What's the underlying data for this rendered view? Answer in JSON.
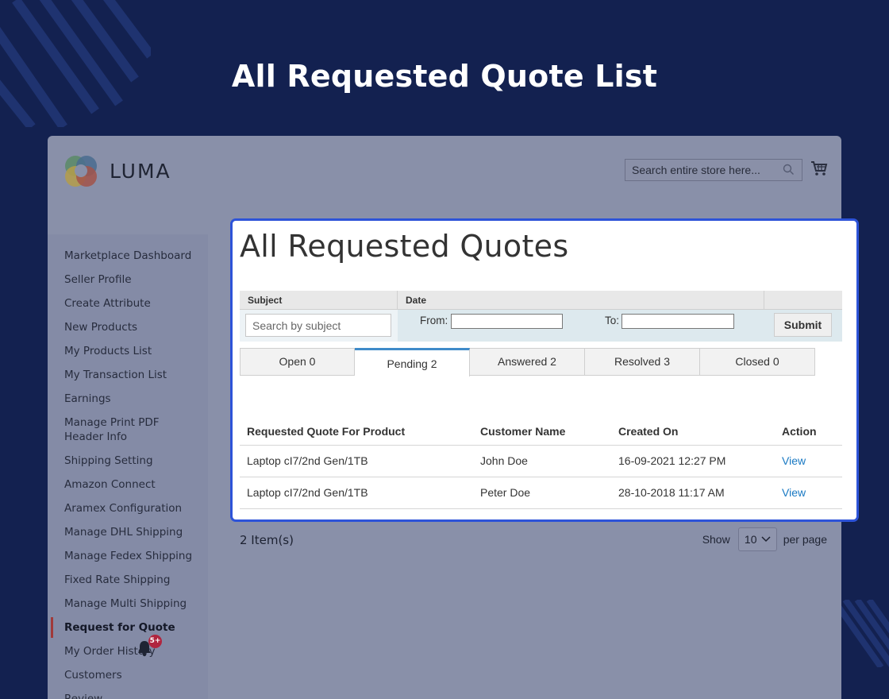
{
  "hero": {
    "title": "All Requested Quote List"
  },
  "colors": {
    "background": "#132150",
    "panel_border": "#2d53d8",
    "link": "#1979c3",
    "tab_active": "#3f8bc9",
    "badge": "#b0253f"
  },
  "header": {
    "logo_text": "LUMA",
    "search_placeholder": "Search entire store here...",
    "search_icon": "search-icon",
    "cart_icon": "cart-icon"
  },
  "sidebar": {
    "items": [
      {
        "label": "Marketplace Dashboard"
      },
      {
        "label": "Seller Profile"
      },
      {
        "label": "Create Attribute"
      },
      {
        "label": "New Products"
      },
      {
        "label": "My Products List"
      },
      {
        "label": "My Transaction List"
      },
      {
        "label": "Earnings"
      },
      {
        "label": "Manage Print PDF Header Info"
      },
      {
        "label": "Shipping Setting"
      },
      {
        "label": "Amazon Connect"
      },
      {
        "label": "Aramex Configuration"
      },
      {
        "label": "Manage DHL Shipping"
      },
      {
        "label": "Manage Fedex Shipping"
      },
      {
        "label": "Fixed Rate Shipping"
      },
      {
        "label": "Manage Multi Shipping"
      },
      {
        "label": "Request for Quote",
        "active": true
      },
      {
        "label": "My Order History",
        "badge": "5+"
      },
      {
        "label": "Customers"
      },
      {
        "label": "Review"
      }
    ]
  },
  "main": {
    "title": "All Requested Quotes",
    "filter": {
      "subject_header": "Subject",
      "date_header": "Date",
      "subject_placeholder": "Search by subject",
      "from_label": "From:",
      "to_label": "To:",
      "submit_label": "Submit"
    },
    "tabs": [
      {
        "label": "Open 0"
      },
      {
        "label": "Pending 2",
        "active": true
      },
      {
        "label": "Answered 2"
      },
      {
        "label": "Resolved 3"
      },
      {
        "label": "Closed 0"
      }
    ],
    "table": {
      "headers": [
        "Requested Quote For Product",
        "Customer Name",
        "Created On",
        "Action"
      ],
      "rows": [
        {
          "product": "Laptop cI7/2nd Gen/1TB",
          "customer": "John Doe",
          "created": "16-09-2021 12:27 PM",
          "action": "View"
        },
        {
          "product": "Laptop cI7/2nd Gen/1TB",
          "customer": "Peter Doe",
          "created": "28-10-2018 11:17 AM",
          "action": "View"
        }
      ]
    },
    "pager": {
      "items_count": "2 Item(s)",
      "show_label": "Show",
      "per_page_value": "10",
      "per_page_label": "per page"
    }
  }
}
